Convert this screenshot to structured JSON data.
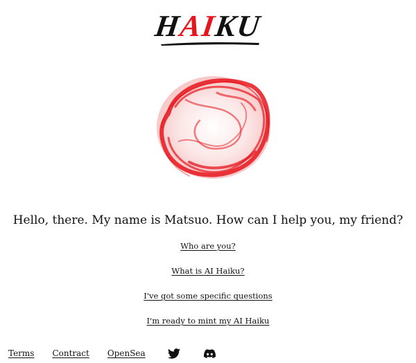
{
  "logo": {
    "letters": [
      "H",
      "A",
      "I",
      "K",
      "U"
    ],
    "accent_color": "#e6161d",
    "text_color": "#111111"
  },
  "hero": {
    "image": "red-ink-circle-enso",
    "color": "#e6161d"
  },
  "greeting": "Hello, there. My name is Matsuo. How can I help you, my friend?",
  "menu": [
    {
      "label": "Who are you?"
    },
    {
      "label": "What is AI Haiku?"
    },
    {
      "label": "I've got some specific questions"
    },
    {
      "label": "I'm ready to mint my AI Haiku"
    }
  ],
  "footer": {
    "links": [
      {
        "label": "Terms"
      },
      {
        "label": "Contract"
      },
      {
        "label": "OpenSea"
      }
    ],
    "icons": [
      "twitter-icon",
      "discord-icon"
    ]
  }
}
